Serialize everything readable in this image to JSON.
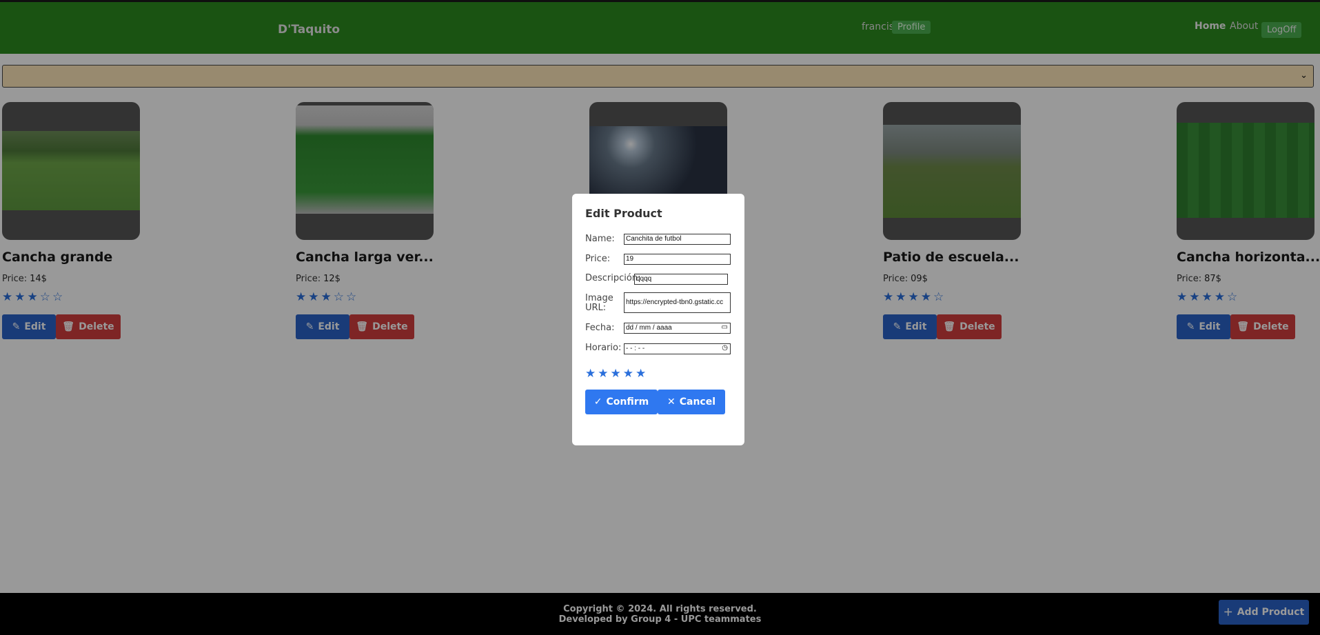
{
  "header": {
    "brand": "D'Taquito",
    "user": "francis",
    "profile_label": "Profile",
    "nav_home": "Home",
    "nav_about": "About",
    "logoff_label": "LogOff",
    "color": "#2c8a1f"
  },
  "filter": {
    "selected": ""
  },
  "cards": [
    {
      "title": "Cancha grande",
      "price_label": "Price:",
      "price": "14$",
      "rating": 3,
      "stars": "★★★☆☆",
      "edit_label": "Edit",
      "delete_label": "Delete"
    },
    {
      "title": "Cancha larga ver...",
      "price_label": "Price:",
      "price": "12$",
      "rating": 3,
      "stars": "★★★☆☆",
      "edit_label": "Edit",
      "delete_label": "Delete"
    },
    {
      "title": "",
      "price_label": "",
      "price": "",
      "rating": 0,
      "stars": "",
      "edit_label": "",
      "delete_label": ""
    },
    {
      "title": "Patio de escuela...",
      "price_label": "Price:",
      "price": "09$",
      "rating": 4,
      "stars": "★★★★☆",
      "edit_label": "Edit",
      "delete_label": "Delete"
    },
    {
      "title": "Cancha horizonta...",
      "price_label": "Price:",
      "price": "87$",
      "rating": 4,
      "stars": "★★★★☆",
      "edit_label": "Edit",
      "delete_label": "Delete"
    }
  ],
  "modal": {
    "title": "Edit Product",
    "name_label": "Name:",
    "name_value": "Canchita de futbol",
    "price_label": "Price:",
    "price_value": "19",
    "desc_label": "Descripción:",
    "desc_value": "qqqq",
    "image_label_1": "Image",
    "image_label_2": "URL:",
    "image_value": "https://encrypted-tbn0.gstatic.cc",
    "fecha_label": "Fecha:",
    "fecha_value": "dd / mm / aaaa",
    "horario_label": "Horario:",
    "horario_value": "- - : - -",
    "rating": 5,
    "stars": "★★★★★",
    "confirm_label": "Confirm",
    "cancel_label": "Cancel"
  },
  "footer": {
    "line1": "Copyright © 2024. All rights reserved.",
    "line2": "Developed by Group 4 - UPC teammates",
    "add_label": "Add Product"
  }
}
